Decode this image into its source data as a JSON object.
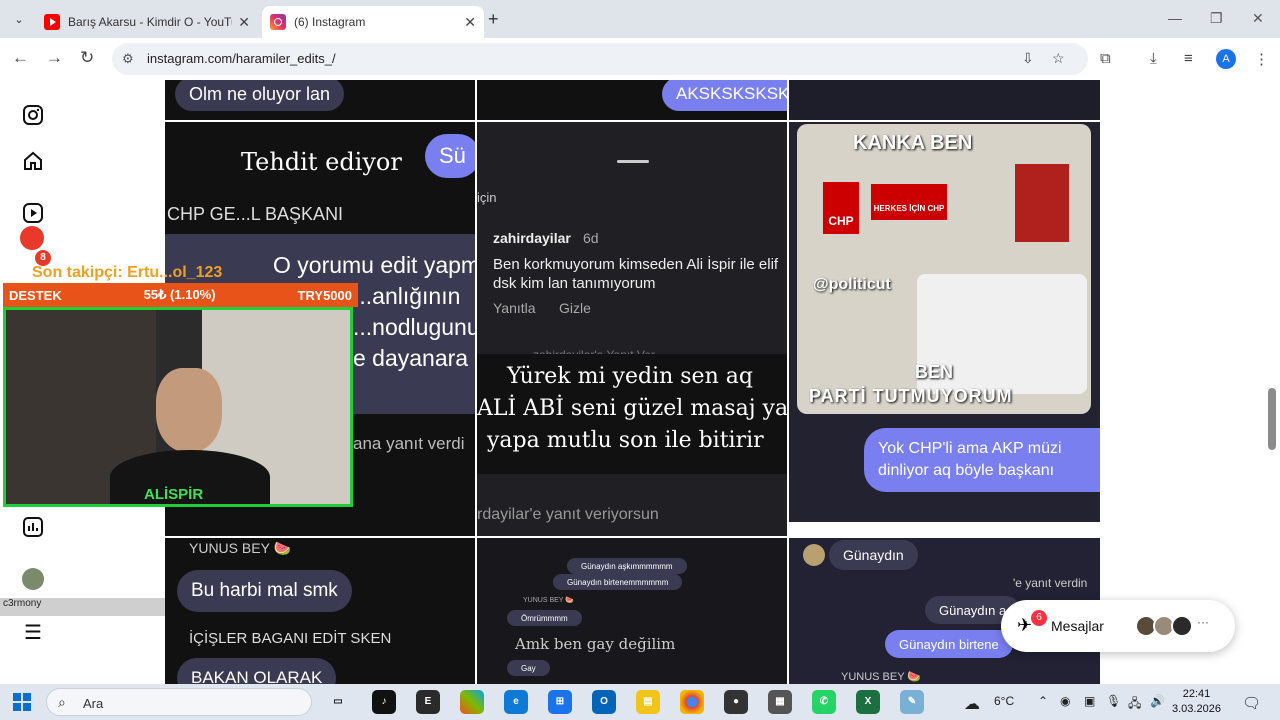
{
  "tabs": [
    {
      "title": "Barış Akarsu - Kimdir O - YouTu",
      "active": false
    },
    {
      "title": "(6) Instagram",
      "active": true
    }
  ],
  "address": {
    "url": "instagram.com/haramiler_edits_/"
  },
  "overlay": {
    "follower_text": "Son takipçi: Ertu...ol_123",
    "destek_label": "DESTEK",
    "destek_amount": "55₺ (1.10%)",
    "destek_goal": "TRY5000",
    "streamer_name": "ALİSPİR",
    "alert_count": "8",
    "chat_user": "c3rmony"
  },
  "posts": {
    "p1": {
      "bubble_top": "Olm ne oluyor lan",
      "caption": "Tehdit ediyor",
      "blue_bubble": "Sü",
      "title": "CHP GE...L BAŞKANI",
      "lines": [
        "O yorumu edit yapmazsan",
        "...anlığının",
        "...nodlugunu",
        "e dayanara"
      ],
      "reply_hint": "ana yanıt verdi"
    },
    "p2": {
      "bubble_top": "AKSKSKSKSK",
      "for_text": "için",
      "username": "zahirdayilar",
      "age": "6d",
      "comment": "Ben korkmuyorum kimseden Ali İspir ile elif dsk kim lan tanımıyorum",
      "reply": "Yanıtla",
      "hide": "Gizle",
      "reply_to": "zahirdayilar'a Yanıt Ver",
      "caption_lines": [
        "Yürek mi yedin sen aq",
        "ALİ ABİ seni güzel masaj yap",
        "yapa  mutlu son ile bitirir"
      ],
      "reply_bar": "rdayilar'e yanıt veriyorsun"
    },
    "p3": {
      "meme_top": "KANKA  BEN",
      "poster1": "CHP",
      "poster2": "HERKES İÇİN CHP",
      "watermark": "@politicut",
      "meme_bottom1": "BEN",
      "meme_bottom2": "PARTİ  TUTMUYORUM",
      "blue_bubble": "Yok CHP'li ama AKP müzi dinliyor aq böyle başkanı"
    },
    "p4": {
      "label": "YUNUS BEY 🍉",
      "bubble": "Bu harbi mal smk",
      "line": "İÇİŞLER BAGANI EDİT SKEN",
      "line2": "BAKAN OLARAK"
    },
    "p5": {
      "s1": "Günaydın aşkımmmmmm",
      "s2": "Günaydın birtenemmmmmm",
      "s3": "YUNUS BEY 🍉",
      "s4": "Ömrümmmm",
      "caption": "Amk ben gay değilim",
      "s5": "Gay"
    },
    "p6": {
      "greet": "Günaydın",
      "replied": "'e yanıt verdin",
      "b1": "Günaydın a",
      "b2": "Günaydın birtene",
      "label": "YUNUS BEY 🍉"
    }
  },
  "messages": {
    "label": "Mesajlar",
    "badge": "6"
  },
  "taskbar": {
    "search_label": "Ara",
    "weather": "6°C",
    "time": "22:41",
    "date": "3.03.2026"
  }
}
